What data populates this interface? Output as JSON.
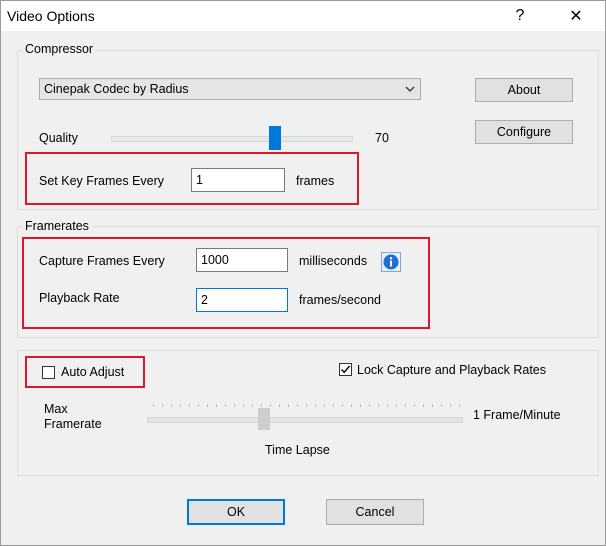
{
  "window": {
    "title": "Video Options",
    "help_glyph": "?",
    "close_glyph": "✕"
  },
  "compressor": {
    "group_label": "Compressor",
    "codec": "Cinepak Codec by Radius",
    "about_label": "About",
    "configure_label": "Configure",
    "quality_label": "Quality",
    "quality_value": "70",
    "quality_level": 70,
    "keyframes_label": "Set Key Frames Every",
    "keyframes_value": "1",
    "keyframes_unit": "frames"
  },
  "framerates": {
    "group_label": "Framerates",
    "capture_label": "Capture Frames Every",
    "capture_value": "1000",
    "capture_unit": "milliseconds",
    "playback_label": "Playback Rate",
    "playback_value": "2",
    "playback_unit": "frames/second"
  },
  "timelapse": {
    "auto_adjust_label": "Auto Adjust",
    "auto_adjust_checked": false,
    "lock_label": "Lock Capture and Playback Rates",
    "lock_checked": true,
    "max_label_line1": "Max",
    "max_label_line2": "Framerate",
    "min_label": "1 Frame/Minute",
    "slider_caption": "Time Lapse"
  },
  "footer": {
    "ok_label": "OK",
    "cancel_label": "Cancel"
  },
  "colors": {
    "accent": "#0078d7",
    "highlight_box": "#d9182a"
  }
}
